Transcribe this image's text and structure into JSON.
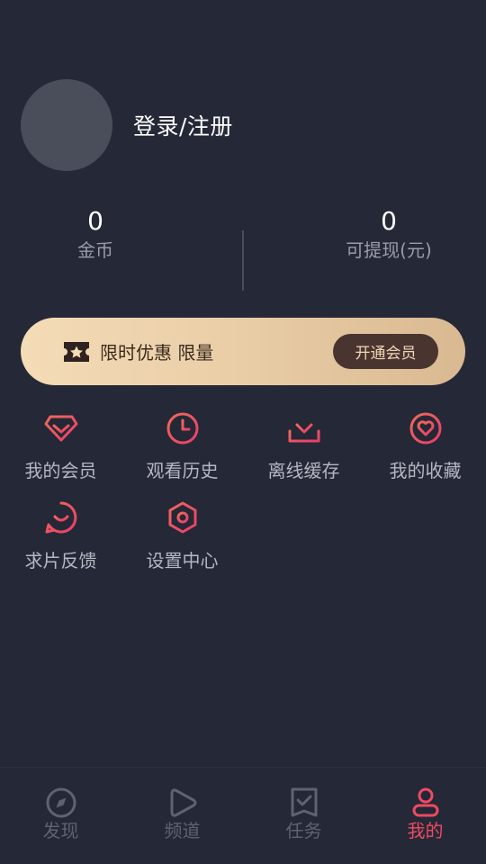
{
  "profile": {
    "login_label": "登录/注册"
  },
  "stats": [
    {
      "value": "0",
      "label": "金币"
    },
    {
      "value": "0",
      "label": "可提现(元)"
    }
  ],
  "vip": {
    "text": "限时优惠 限量",
    "button": "开通会员"
  },
  "features": [
    {
      "label": "我的会员",
      "icon": "diamond-icon"
    },
    {
      "label": "观看历史",
      "icon": "clock-icon"
    },
    {
      "label": "离线缓存",
      "icon": "download-icon"
    },
    {
      "label": "我的收藏",
      "icon": "heart-icon"
    },
    {
      "label": "求片反馈",
      "icon": "chat-smile-icon"
    },
    {
      "label": "设置中心",
      "icon": "settings-hexagon-icon"
    }
  ],
  "tabs": [
    {
      "label": "发现",
      "icon": "compass-icon"
    },
    {
      "label": "频道",
      "icon": "play-icon"
    },
    {
      "label": "任务",
      "icon": "task-check-icon"
    },
    {
      "label": "我的",
      "icon": "user-icon",
      "active": true
    }
  ],
  "colors": {
    "accent": "#ef4a63",
    "background": "#252836",
    "vip_gold": "#e9cda7"
  }
}
